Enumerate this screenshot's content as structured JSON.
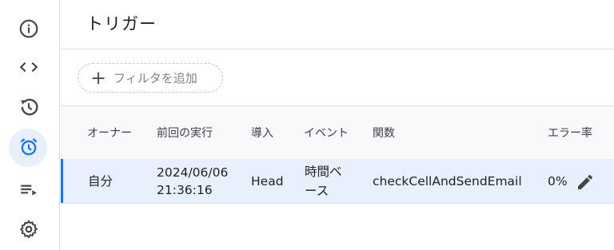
{
  "page": {
    "title": "トリガー"
  },
  "sidebar": {
    "items": [
      {
        "icon": "info-icon",
        "label": ""
      },
      {
        "icon": "code-icon",
        "label": ""
      },
      {
        "icon": "history-icon",
        "label": ""
      },
      {
        "icon": "alarm-icon",
        "label": "",
        "active": true
      },
      {
        "icon": "playlist-icon",
        "label": ""
      },
      {
        "icon": "gear-icon",
        "label": ""
      }
    ]
  },
  "filter": {
    "label": "フィルタを追加"
  },
  "table": {
    "headers": [
      "オーナー",
      "前回の実行",
      "導入",
      "イベント",
      "関数",
      "エラー率"
    ],
    "rows": [
      {
        "owner": "自分",
        "last_run_date": "2024/06/06",
        "last_run_time": "21:36:16",
        "deployment": "Head",
        "event_line1": "時間ベ",
        "event_line2": "ース",
        "function": "checkCellAndSendEmail",
        "error_rate": "0%"
      }
    ]
  },
  "colors": {
    "accent": "#1a73e8",
    "selected_row": "#e8f0fe",
    "header_bg": "#f8f9fa"
  }
}
